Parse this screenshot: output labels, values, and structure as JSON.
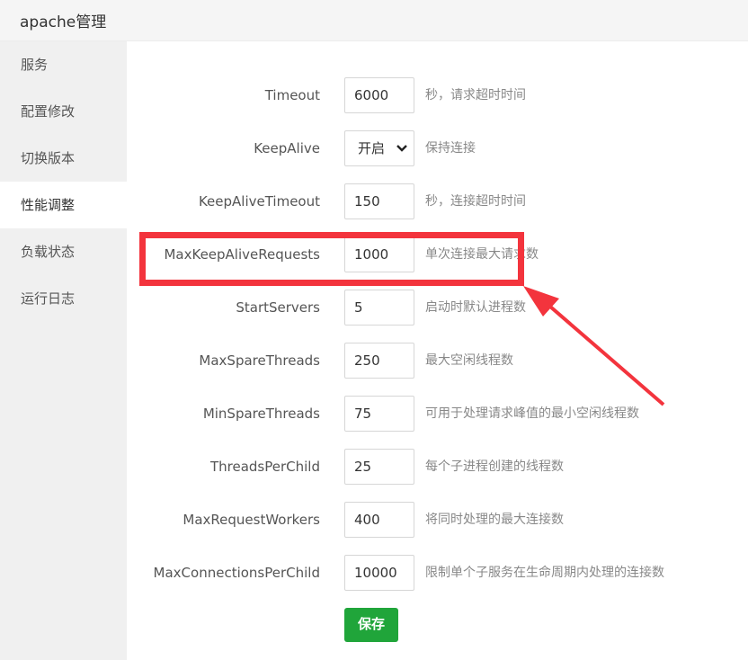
{
  "window": {
    "title": "apache管理"
  },
  "sidebar": {
    "items": [
      {
        "label": "服务"
      },
      {
        "label": "配置修改"
      },
      {
        "label": "切换版本"
      },
      {
        "label": "性能调整",
        "active": true
      },
      {
        "label": "负载状态"
      },
      {
        "label": "运行日志"
      }
    ]
  },
  "form": {
    "rows": [
      {
        "name": "Timeout",
        "value": "6000",
        "hint": "秒，请求超时时间"
      },
      {
        "name": "KeepAlive",
        "value": "开启",
        "type": "select",
        "options": [
          "开启"
        ],
        "hint": "保持连接"
      },
      {
        "name": "KeepAliveTimeout",
        "value": "150",
        "hint": "秒，连接超时时间"
      },
      {
        "name": "MaxKeepAliveRequests",
        "value": "1000",
        "hint": "单次连接最大请求数"
      },
      {
        "name": "StartServers",
        "value": "5",
        "hint": "启动时默认进程数"
      },
      {
        "name": "MaxSpareThreads",
        "value": "250",
        "hint": "最大空闲线程数"
      },
      {
        "name": "MinSpareThreads",
        "value": "75",
        "hint": "可用于处理请求峰值的最小空闲线程数"
      },
      {
        "name": "ThreadsPerChild",
        "value": "25",
        "hint": "每个子进程创建的线程数"
      },
      {
        "name": "MaxRequestWorkers",
        "value": "400",
        "hint": "将同时处理的最大连接数"
      },
      {
        "name": "MaxConnectionsPerChild",
        "value": "10000",
        "hint": "限制单个子服务在生命周期内处理的连接数"
      }
    ],
    "save_label": "保存"
  },
  "annotation": {
    "color": "#f3343d",
    "icon": "arrow-icon"
  },
  "colors": {
    "accent": "#20a53a",
    "sidebar_bg": "#f0f0f0",
    "titlebar_bg": "#f5f5f5"
  }
}
